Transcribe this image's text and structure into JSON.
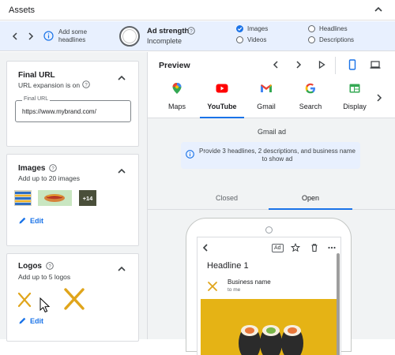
{
  "header": {
    "title": "Assets",
    "collapse_icon": "chevron-up-icon"
  },
  "strength_bar": {
    "hint": "Add some headlines",
    "ad_strength_label": "Ad strength",
    "ad_strength_value": "Incomplete",
    "checklist": [
      {
        "label": "Images",
        "checked": true
      },
      {
        "label": "Headlines",
        "checked": false
      },
      {
        "label": "Videos",
        "checked": false
      },
      {
        "label": "Descriptions",
        "checked": false
      }
    ]
  },
  "final_url": {
    "title": "Final URL",
    "subtitle": "URL expansion is on",
    "field_label": "Final URL",
    "field_value": "https://www.mybrand.com/"
  },
  "images": {
    "title": "Images",
    "subtitle": "Add up to 20 images",
    "more_count": "+14",
    "edit_label": "Edit"
  },
  "logos": {
    "title": "Logos",
    "subtitle": "Add up to 5 logos",
    "edit_label": "Edit"
  },
  "preview": {
    "title": "Preview",
    "apps": [
      "Maps",
      "YouTube",
      "Gmail",
      "Search",
      "Display"
    ],
    "active_app": "YouTube",
    "placement_label": "Gmail ad",
    "notice": "Provide 3 headlines, 2 descriptions, and business name to show ad",
    "modes": [
      "Closed",
      "Open"
    ],
    "active_mode": "Open",
    "phone": {
      "ad_badge": "Ad",
      "headline": "Headline 1",
      "business_name": "Business name",
      "to_me": "to me"
    }
  },
  "colors": {
    "accent": "#1a73e8",
    "strip_bg": "#e8f0fe",
    "panel_bg": "#f1f3f4",
    "hero_yellow": "#e5b315"
  }
}
